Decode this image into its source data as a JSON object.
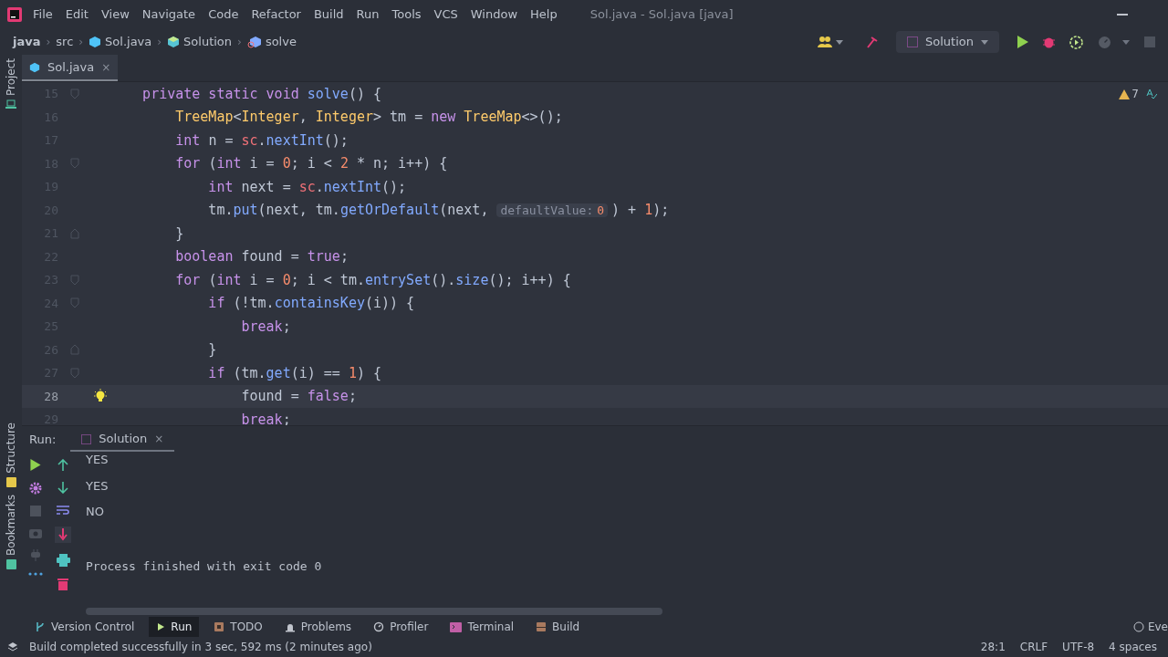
{
  "menu": [
    "File",
    "Edit",
    "View",
    "Navigate",
    "Code",
    "Refactor",
    "Build",
    "Run",
    "Tools",
    "VCS",
    "Window",
    "Help"
  ],
  "window": {
    "title": "Sol.java - Sol.java [java]"
  },
  "breadcrumb_separator": "›",
  "breadcrumbs": [
    "java",
    "src",
    "Sol.java",
    "Solution",
    "solve"
  ],
  "run_config": {
    "label": "Solution"
  },
  "editor_tabs": [
    {
      "label": "Sol.java",
      "close": "×",
      "selected": true
    }
  ],
  "side_tabs_top": [
    "Project"
  ],
  "side_tabs_bottom": [
    "Structure",
    "Bookmarks"
  ],
  "inspections": {
    "warnings": "7"
  },
  "code": [
    {
      "num": "15",
      "kind": "block_start",
      "current": false,
      "tokens": [
        {
          "kind": "keyword",
          "text": "    private static void "
        },
        {
          "kind": "method",
          "text": "solve"
        },
        {
          "kind": "plain",
          "text": "() {"
        }
      ]
    },
    {
      "num": "16",
      "kind": "line",
      "current": false,
      "tokens": [
        {
          "kind": "type",
          "text": "        TreeMap"
        },
        {
          "kind": "plain",
          "text": "<"
        },
        {
          "kind": "type",
          "text": "Integer"
        },
        {
          "kind": "plain",
          "text": ", "
        },
        {
          "kind": "type",
          "text": "Integer"
        },
        {
          "kind": "plain",
          "text": "> tm = "
        },
        {
          "kind": "keyword",
          "text": "new "
        },
        {
          "kind": "type",
          "text": "TreeMap"
        },
        {
          "kind": "plain",
          "text": "<>();"
        }
      ]
    },
    {
      "num": "17",
      "kind": "line",
      "current": false,
      "tokens": [
        {
          "kind": "keyword",
          "text": "        int "
        },
        {
          "kind": "plain",
          "text": "n = "
        },
        {
          "kind": "field",
          "text": "sc"
        },
        {
          "kind": "plain",
          "text": "."
        },
        {
          "kind": "method",
          "text": "nextInt"
        },
        {
          "kind": "plain",
          "text": "();"
        }
      ]
    },
    {
      "num": "18",
      "kind": "block_start",
      "current": false,
      "tokens": [
        {
          "kind": "keyword",
          "text": "        for "
        },
        {
          "kind": "plain",
          "text": "("
        },
        {
          "kind": "keyword",
          "text": "int "
        },
        {
          "kind": "plain",
          "text": "i = "
        },
        {
          "kind": "number",
          "text": "0"
        },
        {
          "kind": "plain",
          "text": "; i < "
        },
        {
          "kind": "number",
          "text": "2"
        },
        {
          "kind": "plain",
          "text": " * n; i++) {"
        }
      ]
    },
    {
      "num": "19",
      "kind": "line",
      "current": false,
      "tokens": [
        {
          "kind": "keyword",
          "text": "            int "
        },
        {
          "kind": "plain",
          "text": "next = "
        },
        {
          "kind": "field",
          "text": "sc"
        },
        {
          "kind": "plain",
          "text": "."
        },
        {
          "kind": "method",
          "text": "nextInt"
        },
        {
          "kind": "plain",
          "text": "();"
        }
      ]
    },
    {
      "num": "20",
      "kind": "line",
      "current": false,
      "tokens": [
        {
          "kind": "plain",
          "text": "            tm."
        },
        {
          "kind": "method",
          "text": "put"
        },
        {
          "kind": "plain",
          "text": "(next, tm."
        },
        {
          "kind": "method",
          "text": "getOrDefault"
        },
        {
          "kind": "plain",
          "text": "(next, "
        },
        {
          "kind": "hint",
          "text": "defaultValue:"
        },
        {
          "kind": "hint_number",
          "text": "0"
        },
        {
          "kind": "plain",
          "text": ") + "
        },
        {
          "kind": "number",
          "text": "1"
        },
        {
          "kind": "plain",
          "text": ");"
        }
      ]
    },
    {
      "num": "21",
      "kind": "block_end",
      "current": false,
      "tokens": [
        {
          "kind": "plain",
          "text": "        }"
        }
      ]
    },
    {
      "num": "22",
      "kind": "line",
      "current": false,
      "tokens": [
        {
          "kind": "keyword",
          "text": "        boolean "
        },
        {
          "kind": "plain",
          "text": "found = "
        },
        {
          "kind": "keyword",
          "text": "true"
        },
        {
          "kind": "plain",
          "text": ";"
        }
      ]
    },
    {
      "num": "23",
      "kind": "block_start",
      "current": false,
      "tokens": [
        {
          "kind": "keyword",
          "text": "        for "
        },
        {
          "kind": "plain",
          "text": "("
        },
        {
          "kind": "keyword",
          "text": "int "
        },
        {
          "kind": "plain",
          "text": "i = "
        },
        {
          "kind": "number",
          "text": "0"
        },
        {
          "kind": "plain",
          "text": "; i < tm."
        },
        {
          "kind": "method",
          "text": "entrySet"
        },
        {
          "kind": "plain",
          "text": "()."
        },
        {
          "kind": "method",
          "text": "size"
        },
        {
          "kind": "plain",
          "text": "(); i++) {"
        }
      ]
    },
    {
      "num": "24",
      "kind": "block_start",
      "current": false,
      "tokens": [
        {
          "kind": "keyword",
          "text": "            if "
        },
        {
          "kind": "plain",
          "text": "(!tm."
        },
        {
          "kind": "method",
          "text": "containsKey"
        },
        {
          "kind": "plain",
          "text": "(i)) {"
        }
      ]
    },
    {
      "num": "25",
      "kind": "line",
      "current": false,
      "tokens": [
        {
          "kind": "keyword",
          "text": "                break"
        },
        {
          "kind": "plain",
          "text": ";"
        }
      ]
    },
    {
      "num": "26",
      "kind": "block_end",
      "current": false,
      "tokens": [
        {
          "kind": "plain",
          "text": "            }"
        }
      ]
    },
    {
      "num": "27",
      "kind": "block_start",
      "current": false,
      "tokens": [
        {
          "kind": "keyword",
          "text": "            if "
        },
        {
          "kind": "plain",
          "text": "(tm."
        },
        {
          "kind": "method",
          "text": "get"
        },
        {
          "kind": "plain",
          "text": "(i) == "
        },
        {
          "kind": "number",
          "text": "1"
        },
        {
          "kind": "plain",
          "text": ") {"
        }
      ]
    },
    {
      "num": "28",
      "kind": "line",
      "current": true,
      "tokens": [
        {
          "kind": "plain",
          "text": "                found = "
        },
        {
          "kind": "keyword",
          "text": "false"
        },
        {
          "kind": "plain",
          "text": ";"
        }
      ]
    },
    {
      "num": "29",
      "kind": "line",
      "current": false,
      "tokens": [
        {
          "kind": "keyword",
          "text": "                break"
        },
        {
          "kind": "plain",
          "text": ";"
        }
      ]
    }
  ],
  "run_panel": {
    "label": "Run:",
    "tab": "Solution",
    "close": "×",
    "output": [
      "YES",
      "YES",
      "NO"
    ],
    "finish": "Process finished with exit code 0"
  },
  "tool_tabs": [
    {
      "label": "Version Control",
      "selected": false
    },
    {
      "label": "Run",
      "selected": true
    },
    {
      "label": "TODO",
      "selected": false
    },
    {
      "label": "Problems",
      "selected": false
    },
    {
      "label": "Profiler",
      "selected": false
    },
    {
      "label": "Terminal",
      "selected": false
    },
    {
      "label": "Build",
      "selected": false
    }
  ],
  "event_log": "Eve",
  "status_bar": {
    "message": "Build completed successfully in 3 sec, 592 ms (2 minutes ago)",
    "items": [
      "28:1",
      "CRLF",
      "UTF-8",
      "4 spaces"
    ]
  }
}
